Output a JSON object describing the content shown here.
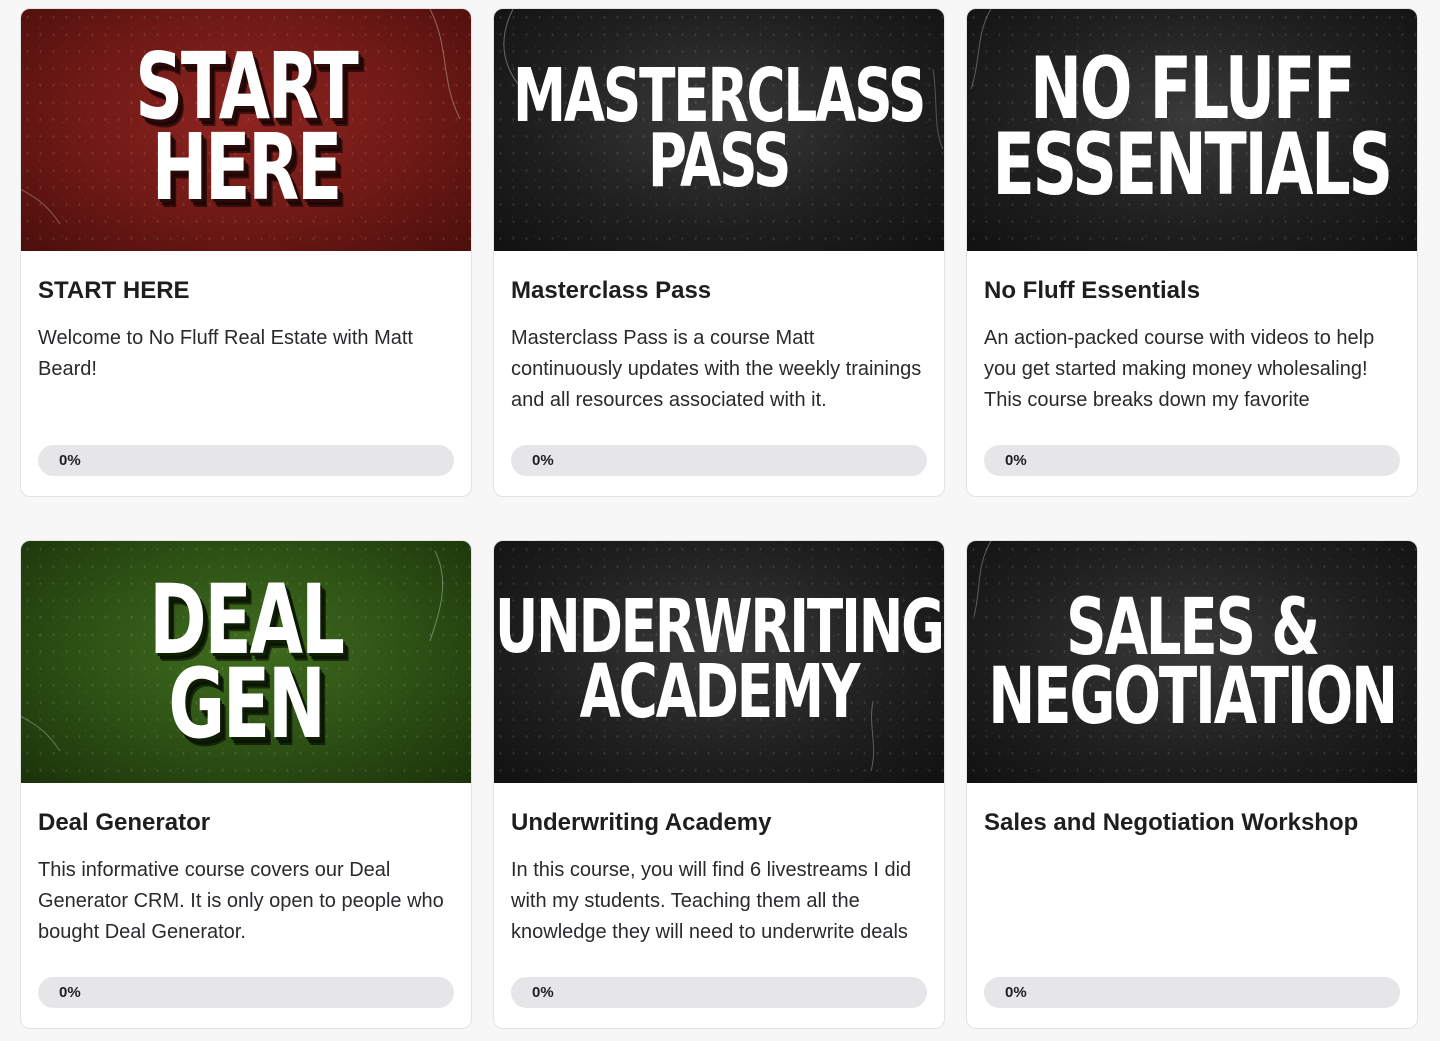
{
  "courses": [
    {
      "thumbnail_text": "START HERE",
      "thumbnail_theme": "red",
      "thumbnail_color": "#6e1915",
      "title": "START HERE",
      "description": "Welcome to No Fluff Real Estate with Matt Beard!",
      "progress_label": "0%",
      "progress": 0
    },
    {
      "thumbnail_text": "MASTERCLASS\nPASS",
      "thumbnail_theme": "dark",
      "thumbnail_color": "#202020",
      "title": "Masterclass Pass",
      "description": "Masterclass Pass is a course Matt continuously updates with the weekly trainings and all resources associated with it.",
      "progress_label": "0%",
      "progress": 0
    },
    {
      "thumbnail_text": "NO FLUFF\nESSENTIALS",
      "thumbnail_theme": "dark",
      "thumbnail_color": "#202020",
      "title": "No Fluff Essentials",
      "description": "An action-packed course with videos to help you get started making money wholesaling! This course breaks down my favorite",
      "progress_label": "0%",
      "progress": 0
    },
    {
      "thumbnail_text": "DEAL GEN",
      "thumbnail_theme": "green",
      "thumbnail_color": "#2c4f14",
      "title": "Deal Generator",
      "description": "This informative course covers our Deal Generator CRM. It is only open to people who bought Deal Generator.",
      "progress_label": "0%",
      "progress": 0
    },
    {
      "thumbnail_text": "UNDERWRITING\nACADEMY",
      "thumbnail_theme": "dark",
      "thumbnail_color": "#202020",
      "title": "Underwriting Academy",
      "description": "In this course, you will find 6 livestreams I did with my students. Teaching them all the knowledge they will need to underwrite deals",
      "progress_label": "0%",
      "progress": 0
    },
    {
      "thumbnail_text": "SALES &\nNEGOTIATION",
      "thumbnail_theme": "dark",
      "thumbnail_color": "#202020",
      "title": "Sales and Negotiation Workshop",
      "description": "",
      "progress_label": "0%",
      "progress": 0
    }
  ],
  "colors": {
    "page_background": "#f7f7f8",
    "card_background": "#ffffff",
    "progress_track": "#e6e6e8",
    "text_primary": "#1e1e21"
  }
}
